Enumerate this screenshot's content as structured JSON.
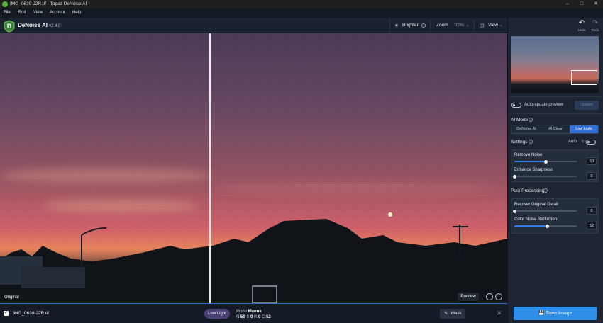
{
  "window": {
    "title": "IMG_0630-J2R.tif - Topaz DeNoise AI"
  },
  "menu": [
    "File",
    "Edit",
    "View",
    "Account",
    "Help"
  ],
  "app": {
    "name": "DeNoise AI",
    "version": "v2.4.0"
  },
  "toolbar": {
    "brighten": "Brighten",
    "zoom_label": "Zoom",
    "zoom_value": "100%",
    "view_label": "View"
  },
  "history": {
    "undo": "Undo",
    "redo": "Redo"
  },
  "viewer": {
    "left_label": "Original",
    "right_label": "Preview"
  },
  "panel": {
    "auto_update": "Auto-update preview",
    "update_button": "Update",
    "ai_mode_label": "AI Mode",
    "modes": [
      "DeNoise AI",
      "AI Clear",
      "Low Light"
    ],
    "active_mode": "Low Light",
    "settings_label": "Settings",
    "auto_label": "Auto",
    "sliders_settings": [
      {
        "label": "Remove Noise",
        "value": "50",
        "fraction": 0.5
      },
      {
        "label": "Enhance Sharpness",
        "value": "0",
        "fraction": 0.0
      }
    ],
    "post_label": "Post-Processing",
    "sliders_post": [
      {
        "label": "Recover Original Detail",
        "value": "0",
        "fraction": 0.0
      },
      {
        "label": "Color Noise Reduction",
        "value": "52",
        "fraction": 0.52
      }
    ]
  },
  "bottom": {
    "filename": "IMG_0630-J2R.tif",
    "mode_pill": "Low Light",
    "mode_prefix": "Mode:",
    "mode_value": "Manual",
    "n_label": "N:",
    "n_value": "50",
    "s_label": "S:",
    "s_value": "0",
    "r_label": "R:",
    "r_value": "0",
    "c_label": "C:",
    "c_value": "52",
    "mask": "Mask",
    "save": "Save Image"
  },
  "colors": {
    "accent": "#2f7de8",
    "pill": "#4b4176",
    "brand_green": "#58b13b"
  }
}
